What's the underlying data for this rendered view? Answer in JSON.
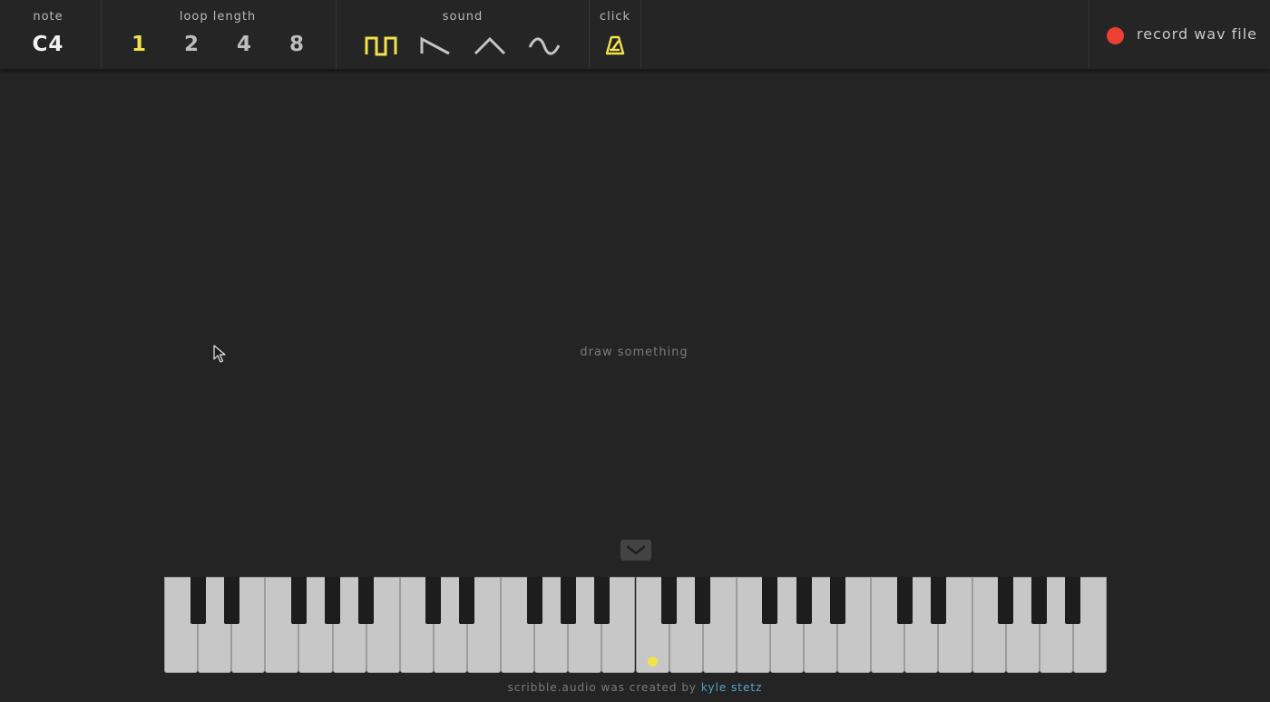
{
  "toolbar": {
    "note_label": "note",
    "note_value": "C4",
    "loop_label": "loop length",
    "loop_options": [
      "1",
      "2",
      "4",
      "8"
    ],
    "loop_selected": "1",
    "sound_label": "sound",
    "sound_options": [
      "square-wave-icon",
      "sawtooth-wave-icon",
      "triangle-wave-icon",
      "sine-wave-icon"
    ],
    "sound_selected": "square-wave-icon",
    "click_label": "click",
    "click_icon": "metronome-icon",
    "record_label": "record wav file",
    "record_icon": "record-dot-icon"
  },
  "canvas": {
    "hint": "draw something"
  },
  "keyboard": {
    "collapse_icon": "chevron-down-icon",
    "white_key_count": 28,
    "active_key": "C4"
  },
  "footer": {
    "credit_prefix": "scribble.audio was created by",
    "credit_link": "kyle stetz"
  },
  "colors": {
    "background": "#252424",
    "toolbar": "#262525",
    "accent_yellow": "#f2e24c",
    "record_red": "#ee3f33",
    "link_blue": "#4fa3cf",
    "white_key": "#c8c7c7",
    "black_key": "#1d1d1d"
  }
}
